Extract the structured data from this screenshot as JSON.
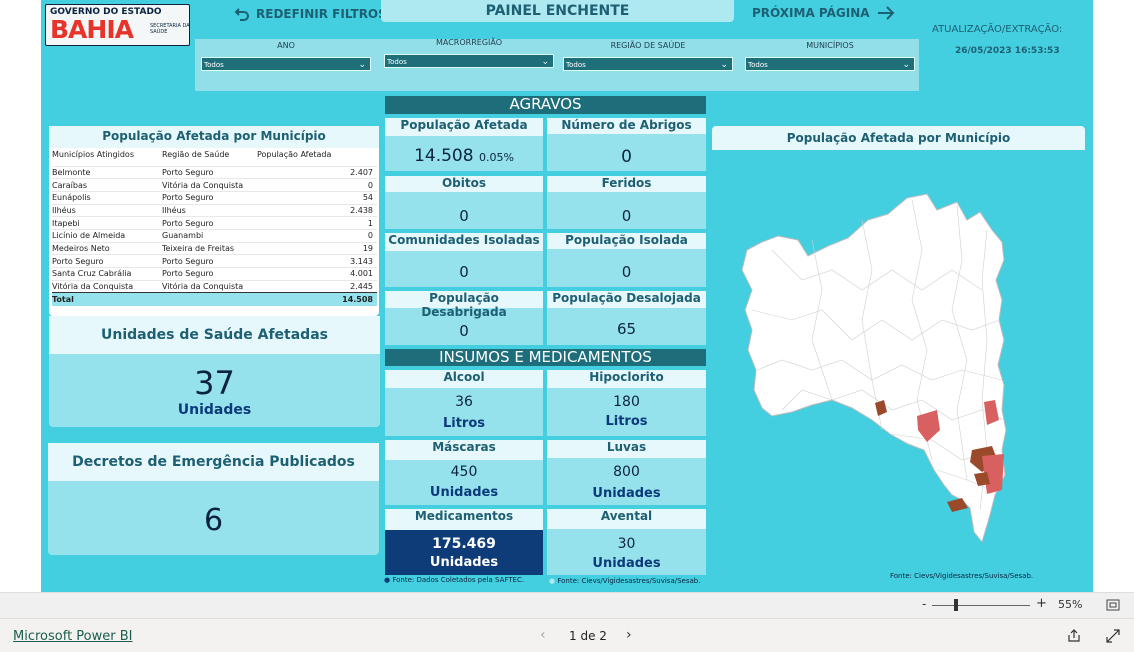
{
  "logo": {
    "line1": "GOVERNO DO ESTADO",
    "line2": "BAHIA",
    "line3": "SECRETARIA DA SAÚDE"
  },
  "nav": {
    "reset": "REDEFINIR FILTROS",
    "title": "PAINEL ENCHENTE",
    "next": "PRÓXIMA PÁGINA"
  },
  "update": {
    "label": "ATUALIZAÇÃO/EXTRAÇÃO:",
    "value": "26/05/2023 16:53:53"
  },
  "filters": [
    {
      "label": "ANO",
      "value": "Todos"
    },
    {
      "label": "MACRORREGIÃO",
      "value": "Todos"
    },
    {
      "label": "REGIÃO DE SAÚDE",
      "value": "Todos"
    },
    {
      "label": "MUNICÍPIOS",
      "value": "Todos"
    }
  ],
  "table": {
    "title": "População Afetada por Município",
    "columns": [
      "Municípios Atingidos",
      "Região de Saúde",
      "População Afetada"
    ],
    "rows": [
      [
        "Belmonte",
        "Porto Seguro",
        "2.407"
      ],
      [
        "Caraíbas",
        "Vitória da Conquista",
        "0"
      ],
      [
        "Eunápolis",
        "Porto Seguro",
        "54"
      ],
      [
        "Ilhéus",
        "Ilhéus",
        "2.438"
      ],
      [
        "Itapebi",
        "Porto Seguro",
        "1"
      ],
      [
        "Licínio de Almeida",
        "Guanambi",
        "0"
      ],
      [
        "Medeiros Neto",
        "Teixeira de Freitas",
        "19"
      ],
      [
        "Porto Seguro",
        "Porto Seguro",
        "3.143"
      ],
      [
        "Santa Cruz Cabrália",
        "Porto Seguro",
        "4.001"
      ],
      [
        "Vitória da Conquista",
        "Vitória da Conquista",
        "2.445"
      ]
    ],
    "total_label": "Total",
    "total_value": "14.508"
  },
  "unidades": {
    "title": "Unidades de Saúde Afetadas",
    "value": "37",
    "unit": "Unidades"
  },
  "decretos": {
    "title": "Decretos de Emergência Publicados",
    "value": "6"
  },
  "agravos": {
    "header": "AGRAVOS",
    "pop_afetada": {
      "label": "População Afetada",
      "value": "14.508",
      "pct": "0.05%"
    },
    "abrigos": {
      "label": "Número de Abrigos",
      "value": "0"
    },
    "obitos": {
      "label": "Obitos",
      "value": "0"
    },
    "feridos": {
      "label": "Feridos",
      "value": "0"
    },
    "comunidades": {
      "label": "Comunidades Isoladas",
      "value": "0"
    },
    "pop_isolada": {
      "label": "População Isolada",
      "value": "0"
    },
    "desabrigada": {
      "label": "População Desabrigada",
      "value": "0"
    },
    "desalojada": {
      "label": "População Desalojada",
      "value": "65"
    }
  },
  "insumos": {
    "header": "INSUMOS E MEDICAMENTOS",
    "alcool": {
      "label": "Alcool",
      "value": "36",
      "unit": "Litros"
    },
    "hipoclorito": {
      "label": "Hipoclorito",
      "value": "180",
      "unit": "Litros"
    },
    "mascaras": {
      "label": "Máscaras",
      "value": "450",
      "unit": "Unidades"
    },
    "luvas": {
      "label": "Luvas",
      "value": "800",
      "unit": "Unidades"
    },
    "medicamentos": {
      "label": "Medicamentos",
      "value": "175.469",
      "unit": "Unidades"
    },
    "avental": {
      "label": "Avental",
      "value": "30",
      "unit": "Unidades"
    }
  },
  "sources": {
    "saftec": "Fonte: Dados Coletados pela SAFTEC.",
    "cievs": "Fonte: Cievs/Vigidesastres/Suvisa/Sesab.",
    "map": "Fonte: Cievs/Vigidesastres/Suvisa/Sesab."
  },
  "map": {
    "title": "População Afetada por Município"
  },
  "zoom": {
    "minus": "-",
    "plus": "+",
    "value": "55%"
  },
  "footer": {
    "brand": "Microsoft Power BI",
    "pages": "1 de 2"
  }
}
